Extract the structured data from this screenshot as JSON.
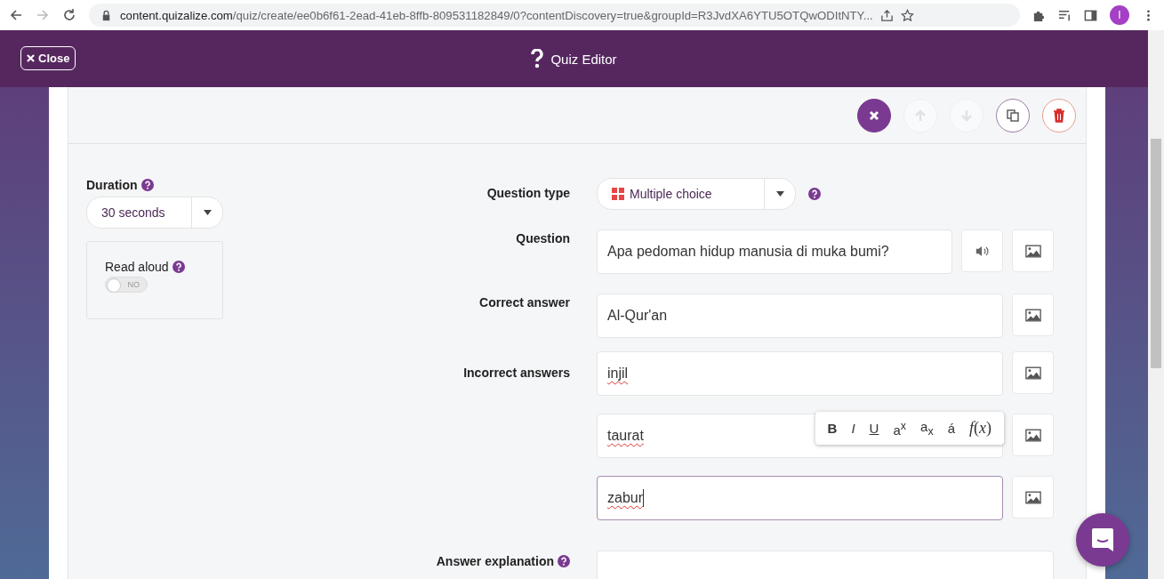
{
  "browser": {
    "url_host": "content.quizalize.com",
    "url_path": "/quiz/create/ee0b6f61-2ead-41eb-8ffb-809531182849/0?contentDiscovery=true&groupId=R3JvdXA6YTU5OTQwODItNTY...",
    "profile_initial": "I"
  },
  "header": {
    "close_label": "Close",
    "title": "Quiz Editor"
  },
  "question_toolbar": [
    {
      "kind": "close",
      "disabled": false
    },
    {
      "kind": "up",
      "disabled": true
    },
    {
      "kind": "down",
      "disabled": true
    },
    {
      "kind": "copy",
      "disabled": false
    },
    {
      "kind": "delete",
      "disabled": false
    }
  ],
  "duration": {
    "label": "Duration",
    "value": "30 seconds"
  },
  "read_aloud": {
    "label": "Read aloud",
    "on": false,
    "toggle_text": "NO"
  },
  "question_type": {
    "label": "Question type",
    "value": "Multiple choice"
  },
  "question": {
    "label": "Question",
    "value": "Apa pedoman hidup manusia di muka bumi?"
  },
  "correct_answer": {
    "label": "Correct answer",
    "value": "Al-Qur'an"
  },
  "incorrect_answers": {
    "label": "Incorrect answers",
    "items": [
      {
        "value": "injil",
        "focused": false,
        "misspelled": true
      },
      {
        "value": "taurat",
        "focused": false,
        "misspelled": true
      },
      {
        "value": "zabur",
        "focused": true,
        "misspelled": true
      }
    ]
  },
  "format_toolbar": [
    {
      "kind": "bold",
      "label": "B"
    },
    {
      "kind": "italic",
      "label": "I"
    },
    {
      "kind": "underline",
      "label": "U"
    },
    {
      "kind": "superscript",
      "label": "a$^{x}$"
    },
    {
      "kind": "subscript",
      "label": "a$_{x}$"
    },
    {
      "kind": "accent",
      "label": "á"
    },
    {
      "kind": "formula",
      "label": "*f*(*x*)"
    }
  ],
  "answer_explanation": {
    "label": "Answer explanation"
  }
}
